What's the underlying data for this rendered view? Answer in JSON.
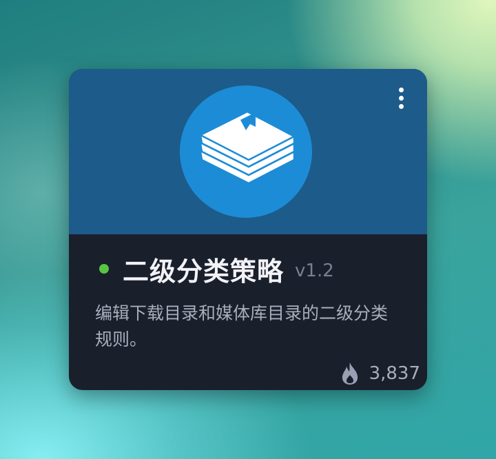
{
  "card": {
    "title": "二级分类策略",
    "version": "v1.2",
    "description": "编辑下载目录和媒体库目录的二级分类规则。",
    "status": "active",
    "status_color": "#57c443",
    "download_count": "3,837",
    "icons": {
      "logo": "books-stack-icon",
      "menu": "more-vertical-icon",
      "stat": "flame-icon"
    }
  }
}
